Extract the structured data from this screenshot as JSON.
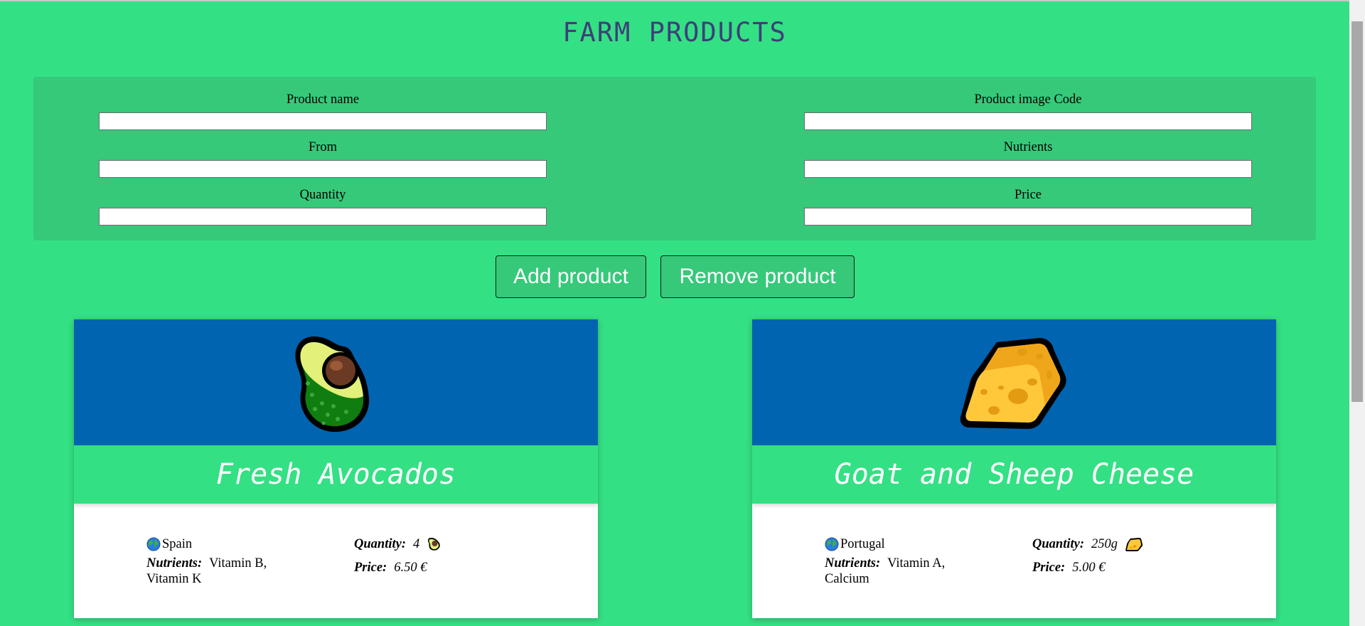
{
  "page": {
    "title": "FARM PRODUCTS"
  },
  "form": {
    "fields": [
      {
        "label": "Product name",
        "value": "",
        "placeholder": ""
      },
      {
        "label": "Product image Code",
        "value": "",
        "placeholder": ""
      },
      {
        "label": "From",
        "value": "",
        "placeholder": ""
      },
      {
        "label": "Nutrients",
        "value": "",
        "placeholder": ""
      },
      {
        "label": "Quantity",
        "value": "",
        "placeholder": ""
      },
      {
        "label": "Price",
        "value": "",
        "placeholder": ""
      }
    ]
  },
  "buttons": {
    "add_label": "Add product",
    "remove_label": "Remove product"
  },
  "products": [
    {
      "name": "Fresh Avocados",
      "image_icon": "avocado-icon",
      "from": "Spain",
      "nutrients_label": "Nutrients:",
      "nutrients": "Vitamin B, Vitamin K",
      "quantity_label": "Quantity:",
      "quantity": "4",
      "price_label": "Price:",
      "price": "6.50 €"
    },
    {
      "name": "Goat and Sheep Cheese",
      "image_icon": "cheese-icon",
      "from": "Portugal",
      "nutrients_label": "Nutrients:",
      "nutrients": "Vitamin A, Calcium",
      "quantity_label": "Quantity:",
      "quantity": "250g",
      "price_label": "Price:",
      "price": "5.00 €"
    }
  ],
  "colors": {
    "background": "#34e084",
    "panel": "#36c97a",
    "card_image_bg": "#0064b0",
    "title": "#3d3f7a"
  }
}
